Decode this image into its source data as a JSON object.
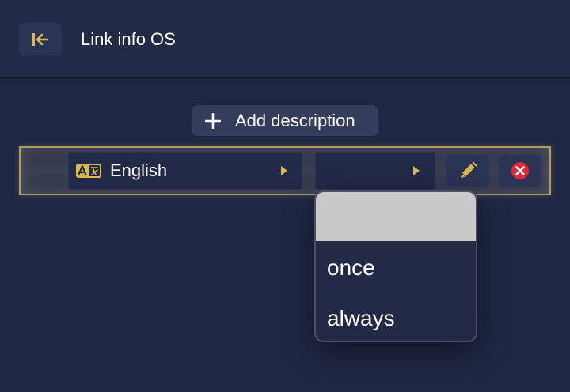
{
  "header": {
    "title": "Link info OS",
    "back_icon": "collapse-left-icon"
  },
  "actions": {
    "add_label": "Add description"
  },
  "row": {
    "language": {
      "value": "English",
      "icon": "translate-icon"
    },
    "mode": {
      "value": ""
    },
    "edit_icon": "pencil-icon",
    "delete_icon": "close-circle-icon"
  },
  "dropdown": {
    "options": [
      "",
      "once",
      "always"
    ],
    "highlighted_index": 0
  },
  "colors": {
    "background": "#1f2744",
    "accent_gold": "#d9b84f",
    "delete_red": "#e0283a",
    "highlight": "#c9c9c9"
  }
}
